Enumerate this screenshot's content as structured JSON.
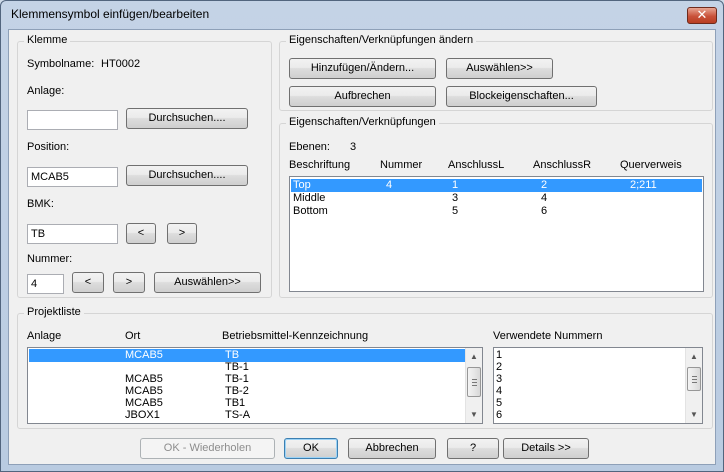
{
  "window": {
    "title": "Klemmensymbol einfügen/bearbeiten",
    "close_glyph": "✕"
  },
  "klemme": {
    "title": "Klemme",
    "symbolname_label": "Symbolname:",
    "symbolname_value": "HT0002",
    "anlage_label": "Anlage:",
    "anlage_value": "",
    "browse1": "Durchsuchen....",
    "position_label": "Position:",
    "position_value": "MCAB5",
    "browse2": "Durchsuchen....",
    "bmk_label": "BMK:",
    "bmk_value": "TB",
    "prev": "<",
    "next": ">",
    "nummer_label": "Nummer:",
    "nummer_value": "4",
    "num_prev": "<",
    "num_next": ">",
    "select": "Auswählen>>"
  },
  "eig_aendern": {
    "title": "Eigenschaften/Verknüpfungen ändern",
    "add_change": "Hinzufügen/Ändern...",
    "select": "Auswählen>>",
    "break": "Aufbrechen",
    "block_props": "Blockeigenschaften..."
  },
  "eig": {
    "title": "Eigenschaften/Verknüpfungen",
    "ebenen_label": "Ebenen:",
    "ebenen_value": "3",
    "columns": [
      "Beschriftung",
      "Nummer",
      "AnschlussL",
      "AnschlussR",
      "Querverweis"
    ],
    "rows": [
      {
        "beschriftung": "Top",
        "nummer": "4",
        "anschlussL": "1",
        "anschlussR": "2",
        "querverweis": "2;211",
        "selected": true
      },
      {
        "beschriftung": "Middle",
        "nummer": "",
        "anschlussL": "3",
        "anschlussR": "4",
        "querverweis": "",
        "selected": false
      },
      {
        "beschriftung": "Bottom",
        "nummer": "",
        "anschlussL": "5",
        "anschlussR": "6",
        "querverweis": "",
        "selected": false
      }
    ]
  },
  "projektliste": {
    "title": "Projektliste",
    "columns": [
      "Anlage",
      "Ort",
      "Betriebsmittel-Kennzeichnung"
    ],
    "rows": [
      {
        "anlage": "",
        "ort": "MCAB5",
        "bmk": "TB",
        "selected": true
      },
      {
        "anlage": "",
        "ort": "",
        "bmk": "TB-1",
        "selected": false
      },
      {
        "anlage": "",
        "ort": "MCAB5",
        "bmk": "TB-1",
        "selected": false
      },
      {
        "anlage": "",
        "ort": "MCAB5",
        "bmk": "TB-2",
        "selected": false
      },
      {
        "anlage": "",
        "ort": "MCAB5",
        "bmk": "TB1",
        "selected": false
      },
      {
        "anlage": "",
        "ort": "JBOX1",
        "bmk": "TS-A",
        "selected": false
      }
    ],
    "used_numbers_header": "Verwendete Nummern",
    "used_numbers": [
      "1",
      "2",
      "3",
      "4",
      "5",
      "6"
    ]
  },
  "footer": {
    "ok_repeat": "OK - Wiederholen",
    "ok": "OK",
    "cancel": "Abbrechen",
    "help": "?",
    "details": "Details >>"
  },
  "scroll": {
    "up": "▲",
    "down": "▼"
  }
}
